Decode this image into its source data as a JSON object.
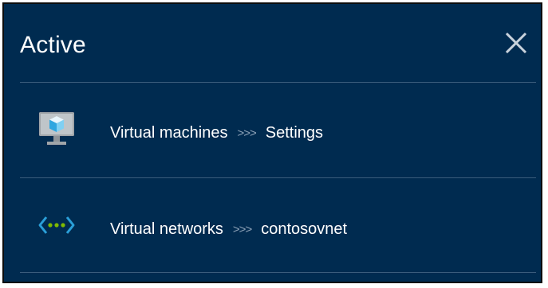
{
  "panel": {
    "title": "Active",
    "close_icon": "close-icon"
  },
  "items": [
    {
      "icon": "virtual-machine-icon",
      "parent": "Virtual machines",
      "separator": ">>>",
      "child": "Settings"
    },
    {
      "icon": "virtual-network-icon",
      "parent": "Virtual networks",
      "separator": ">>>",
      "child": "contosovnet"
    }
  ],
  "colors": {
    "background": "#002b50",
    "text": "#ffffff",
    "divider": "#3a5c7c",
    "vm_cube": "#7fd0f3",
    "vnet_chevron": "#2a9fd8",
    "vnet_dots": "#7fba00"
  }
}
